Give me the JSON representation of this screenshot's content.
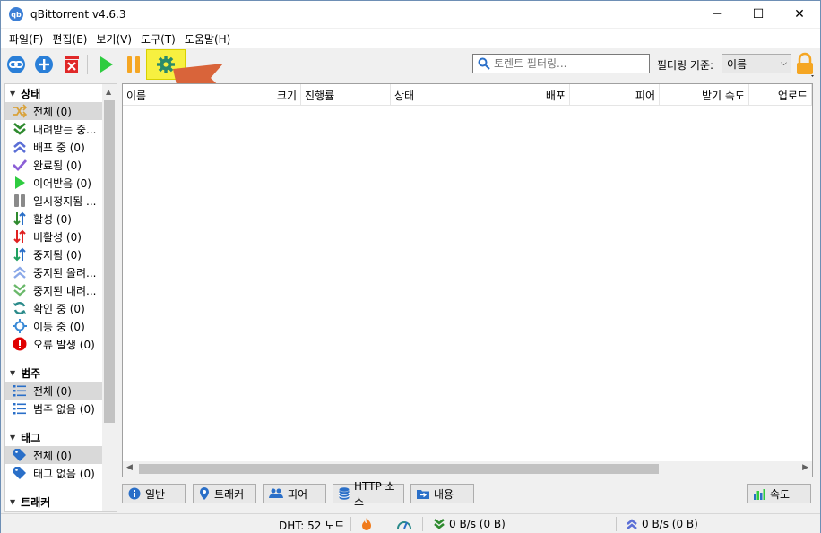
{
  "window": {
    "title": "qBittorrent v4.6.3",
    "app_icon_text": "qb",
    "minimize": "─",
    "maximize": "☐",
    "close": "✕"
  },
  "menu": [
    "파일(F)",
    "편집(E)",
    "보기(V)",
    "도구(T)",
    "도움말(H)"
  ],
  "toolbar": {
    "buttons": [
      "link-icon",
      "add-icon",
      "remove-icon",
      "play-icon",
      "pause-icon",
      "gear-icon"
    ],
    "highlighted": "gear-icon",
    "search_placeholder": "토렌트 필터링...",
    "filter_label": "필터링 기준:",
    "filter_value": "이름"
  },
  "sidebar": {
    "status_title": "상태",
    "status_items": [
      {
        "label": "전체 (0)",
        "icon": "shuffle-icon",
        "color": "#d9a23a"
      },
      {
        "label": "내려받는 중...",
        "icon": "download-chevron-icon",
        "color": "#2e8a2e"
      },
      {
        "label": "배포 중 (0)",
        "icon": "upload-chevron-icon",
        "color": "#5b6fd6"
      },
      {
        "label": "완료됨 (0)",
        "icon": "check-icon",
        "color": "#8b5fd6"
      },
      {
        "label": "이어받음 (0)",
        "icon": "resume-icon",
        "color": "#2ecc40"
      },
      {
        "label": "일시정지됨 ...",
        "icon": "paused-icon",
        "color": "#8a8a8a"
      },
      {
        "label": "활성 (0)",
        "icon": "active-arrows-icon",
        "color": "#2e8a2e"
      },
      {
        "label": "비활성 (0)",
        "icon": "inactive-arrows-icon",
        "color": "#e02020"
      },
      {
        "label": "중지됨 (0)",
        "icon": "stopped-arrows-icon",
        "color": "#20a060"
      },
      {
        "label": "중지된 올려...",
        "icon": "stopped-upload-icon",
        "color": "#8aa8e8"
      },
      {
        "label": "중지된 내려...",
        "icon": "stopped-download-icon",
        "color": "#6ab86a"
      },
      {
        "label": "확인 중 (0)",
        "icon": "refresh-icon",
        "color": "#2a8a8a"
      },
      {
        "label": "이동 중 (0)",
        "icon": "moving-icon",
        "color": "#3a8ad6"
      },
      {
        "label": "오류 발생 (0)",
        "icon": "error-icon",
        "color": "#e00000"
      }
    ],
    "category_title": "범주",
    "category_items": [
      {
        "label": "전체 (0)",
        "icon": "list-icon"
      },
      {
        "label": "범주 없음 (0)",
        "icon": "list-icon"
      }
    ],
    "tag_title": "태그",
    "tag_items": [
      {
        "label": "전체 (0)",
        "icon": "tag-icon"
      },
      {
        "label": "태그 없음 (0)",
        "icon": "tag-icon"
      }
    ],
    "tracker_title": "트래커"
  },
  "columns": [
    "이름",
    "크기",
    "진행률",
    "상태",
    "배포",
    "피어",
    "받기 속도",
    "업로드"
  ],
  "bottom_tabs": [
    "일반",
    "트래커",
    "피어",
    "HTTP 소스",
    "내용",
    "속도"
  ],
  "status": {
    "dht": "DHT: 52 노드",
    "down": "0 B/s (0 B)",
    "up": "0 B/s (0 B)"
  },
  "colors": {
    "highlight": "#f7f040",
    "arrow": "#d9643a"
  }
}
